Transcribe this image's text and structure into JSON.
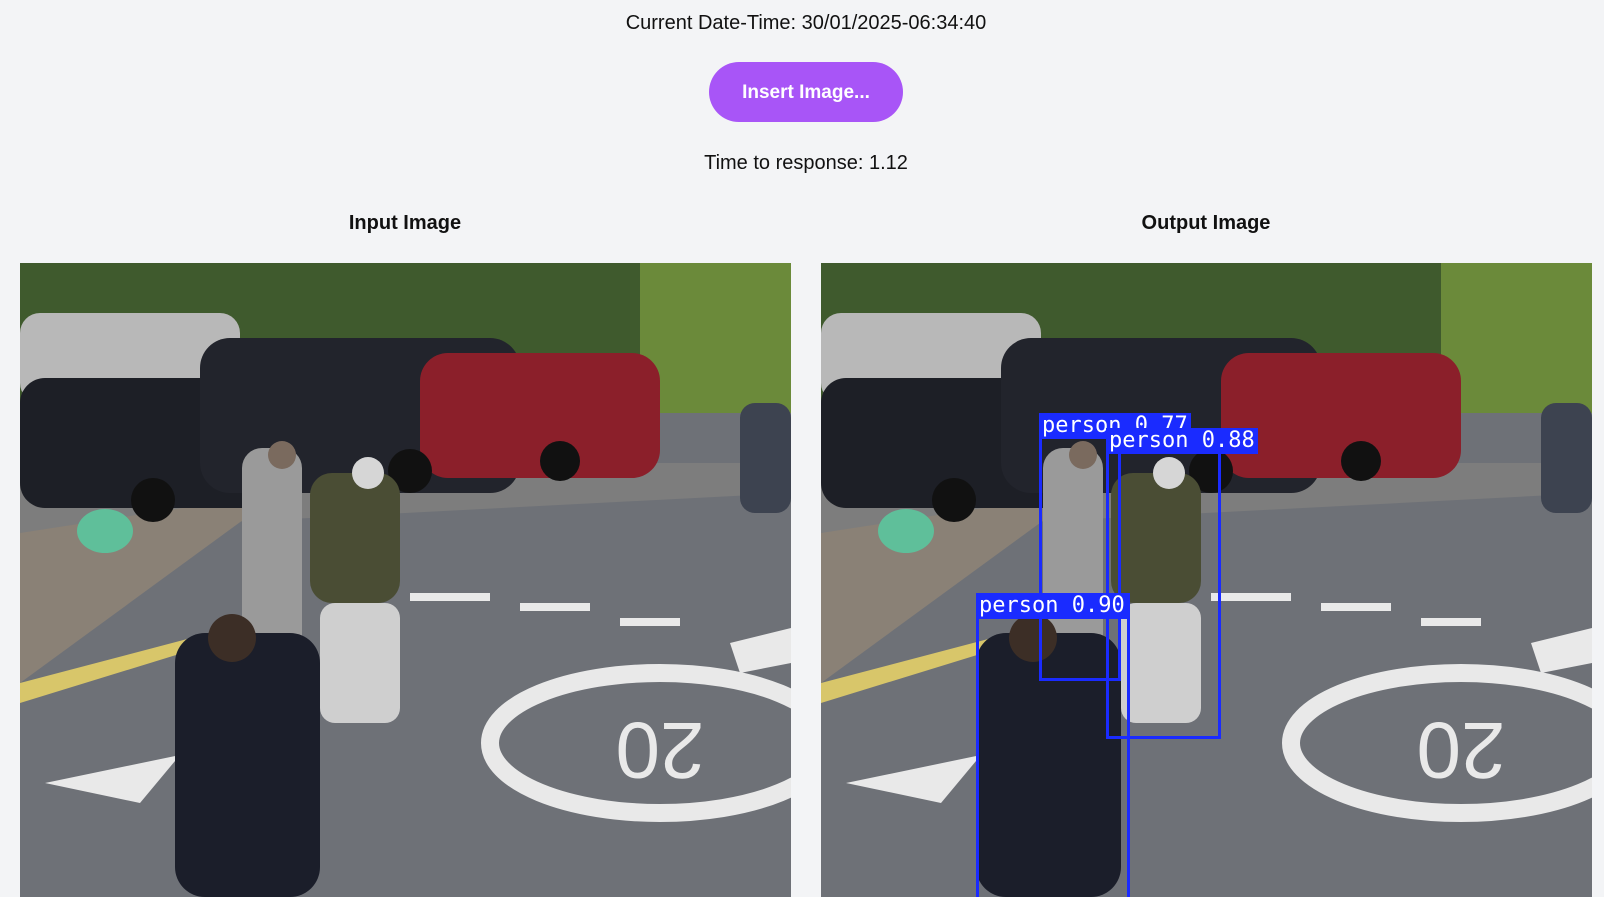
{
  "header": {
    "datetime": "Current Date-Time: 30/01/2025-06:34:40",
    "insert_button_label": "Insert Image...",
    "response_time": "Time to response: 1.12"
  },
  "columns": {
    "input_title": "Input Image",
    "output_title": "Output Image"
  },
  "detections": [
    {
      "label": "person 0.77"
    },
    {
      "label": "person 0.88"
    },
    {
      "label": "person 0.90"
    }
  ],
  "colors": {
    "button": "#a855f7",
    "detection": "#1a2bff",
    "background": "#f3f4f6"
  }
}
